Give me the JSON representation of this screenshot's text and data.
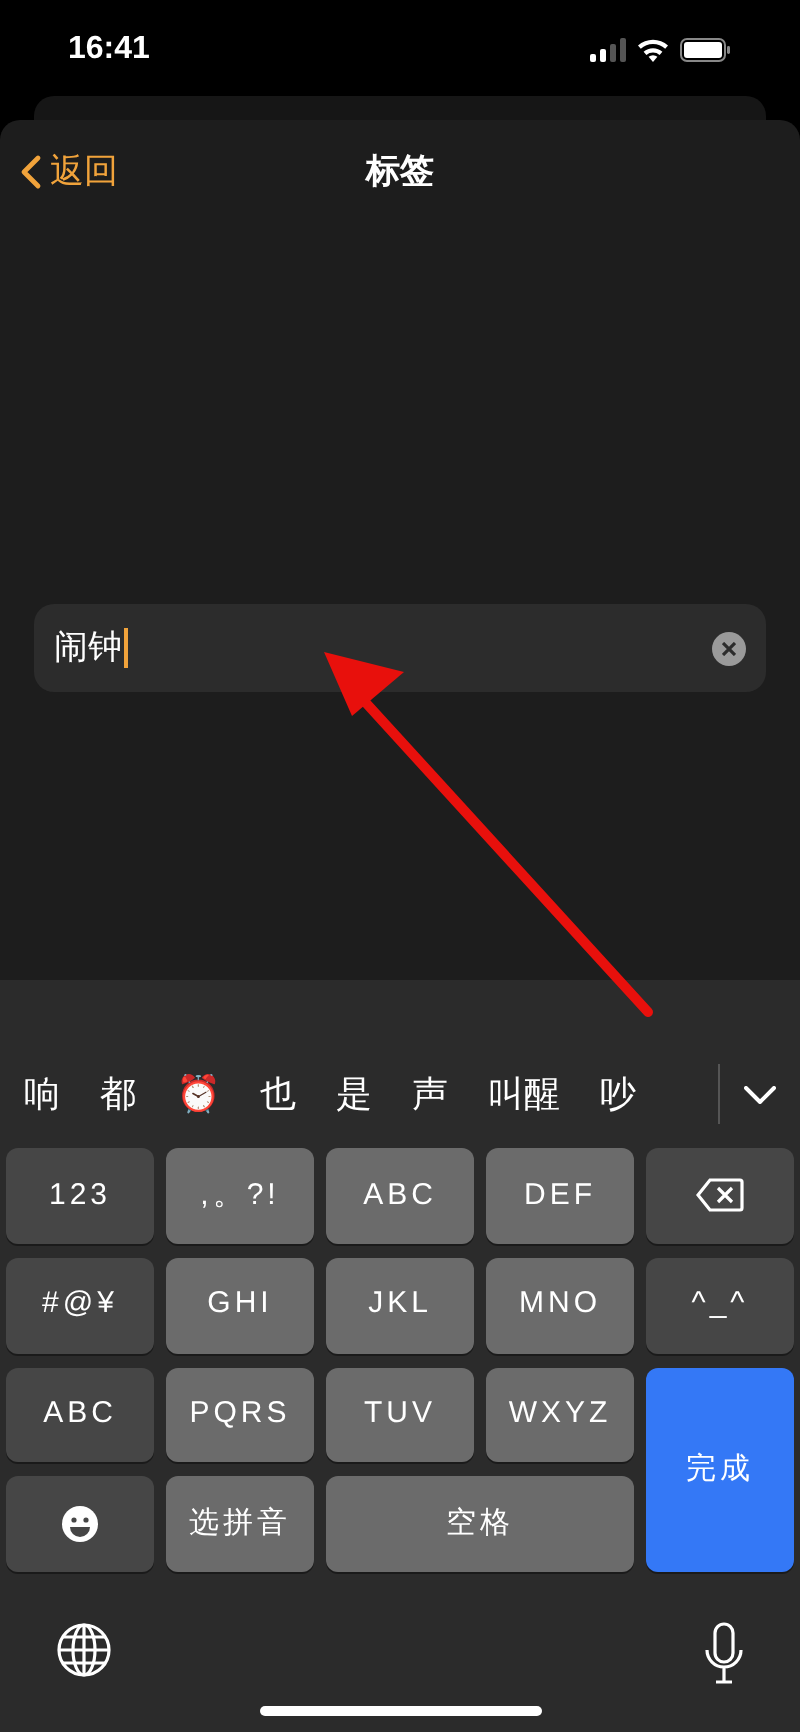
{
  "status_bar": {
    "time": "16:41"
  },
  "nav": {
    "back": "返回",
    "title": "标签"
  },
  "field": {
    "value": "闹钟"
  },
  "candidates": [
    "响",
    "都",
    "⏰",
    "也",
    "是",
    "声",
    "叫醒",
    "吵"
  ],
  "keys": [
    {
      "kind": "function",
      "label": "123"
    },
    {
      "kind": "letter",
      "label": ",。?!"
    },
    {
      "kind": "letter",
      "label": "ABC"
    },
    {
      "kind": "letter",
      "label": "DEF"
    },
    {
      "kind": "backspace"
    },
    {
      "kind": "function",
      "label": "#@¥"
    },
    {
      "kind": "letter",
      "label": "GHI"
    },
    {
      "kind": "letter",
      "label": "JKL"
    },
    {
      "kind": "letter",
      "label": "MNO"
    },
    {
      "kind": "function",
      "label": "^_^"
    },
    {
      "kind": "function",
      "label": "ABC"
    },
    {
      "kind": "letter",
      "label": "PQRS"
    },
    {
      "kind": "letter",
      "label": "TUV"
    },
    {
      "kind": "letter",
      "label": "WXYZ"
    },
    {
      "kind": "done",
      "label": "完成"
    },
    {
      "kind": "emoji"
    },
    {
      "kind": "letter",
      "label": "选拼音"
    },
    {
      "kind": "space",
      "label": "空格"
    }
  ]
}
